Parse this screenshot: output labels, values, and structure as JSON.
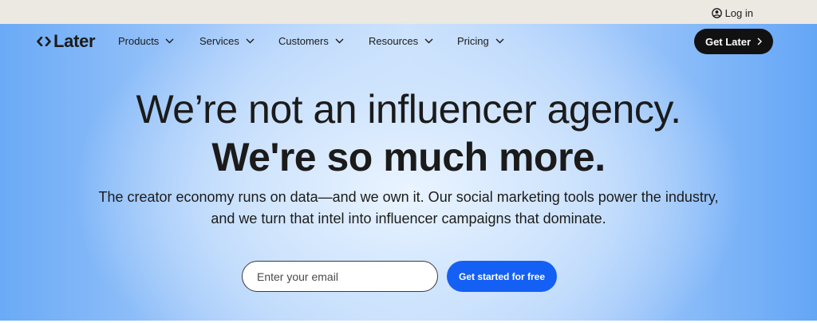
{
  "topbar": {
    "login_label": "Log in",
    "login_icon": "user-circle-icon"
  },
  "header": {
    "logo_text": "Later",
    "logo_icon": "double-chevron-icon",
    "nav": [
      {
        "label": "Products"
      },
      {
        "label": "Services"
      },
      {
        "label": "Customers"
      },
      {
        "label": "Resources"
      },
      {
        "label": "Pricing"
      }
    ],
    "cta_label": "Get Later"
  },
  "hero": {
    "headline_line1": "We’re not an influencer agency.",
    "headline_line2": "We're so much more.",
    "subtext": "The creator economy runs on data—and we own it. Our social marketing tools power the industry, and we turn that intel into influencer campaigns that dominate.",
    "email_placeholder": "Enter your email",
    "cta_label": "Get started for free"
  },
  "colors": {
    "topbar_bg": "#ece8e2",
    "hero_edge_blue": "#64a6f6",
    "hero_center": "#eaf4ff",
    "primary_button": "#1560f4",
    "dark_button": "#111111",
    "text": "#1b1b1b"
  }
}
